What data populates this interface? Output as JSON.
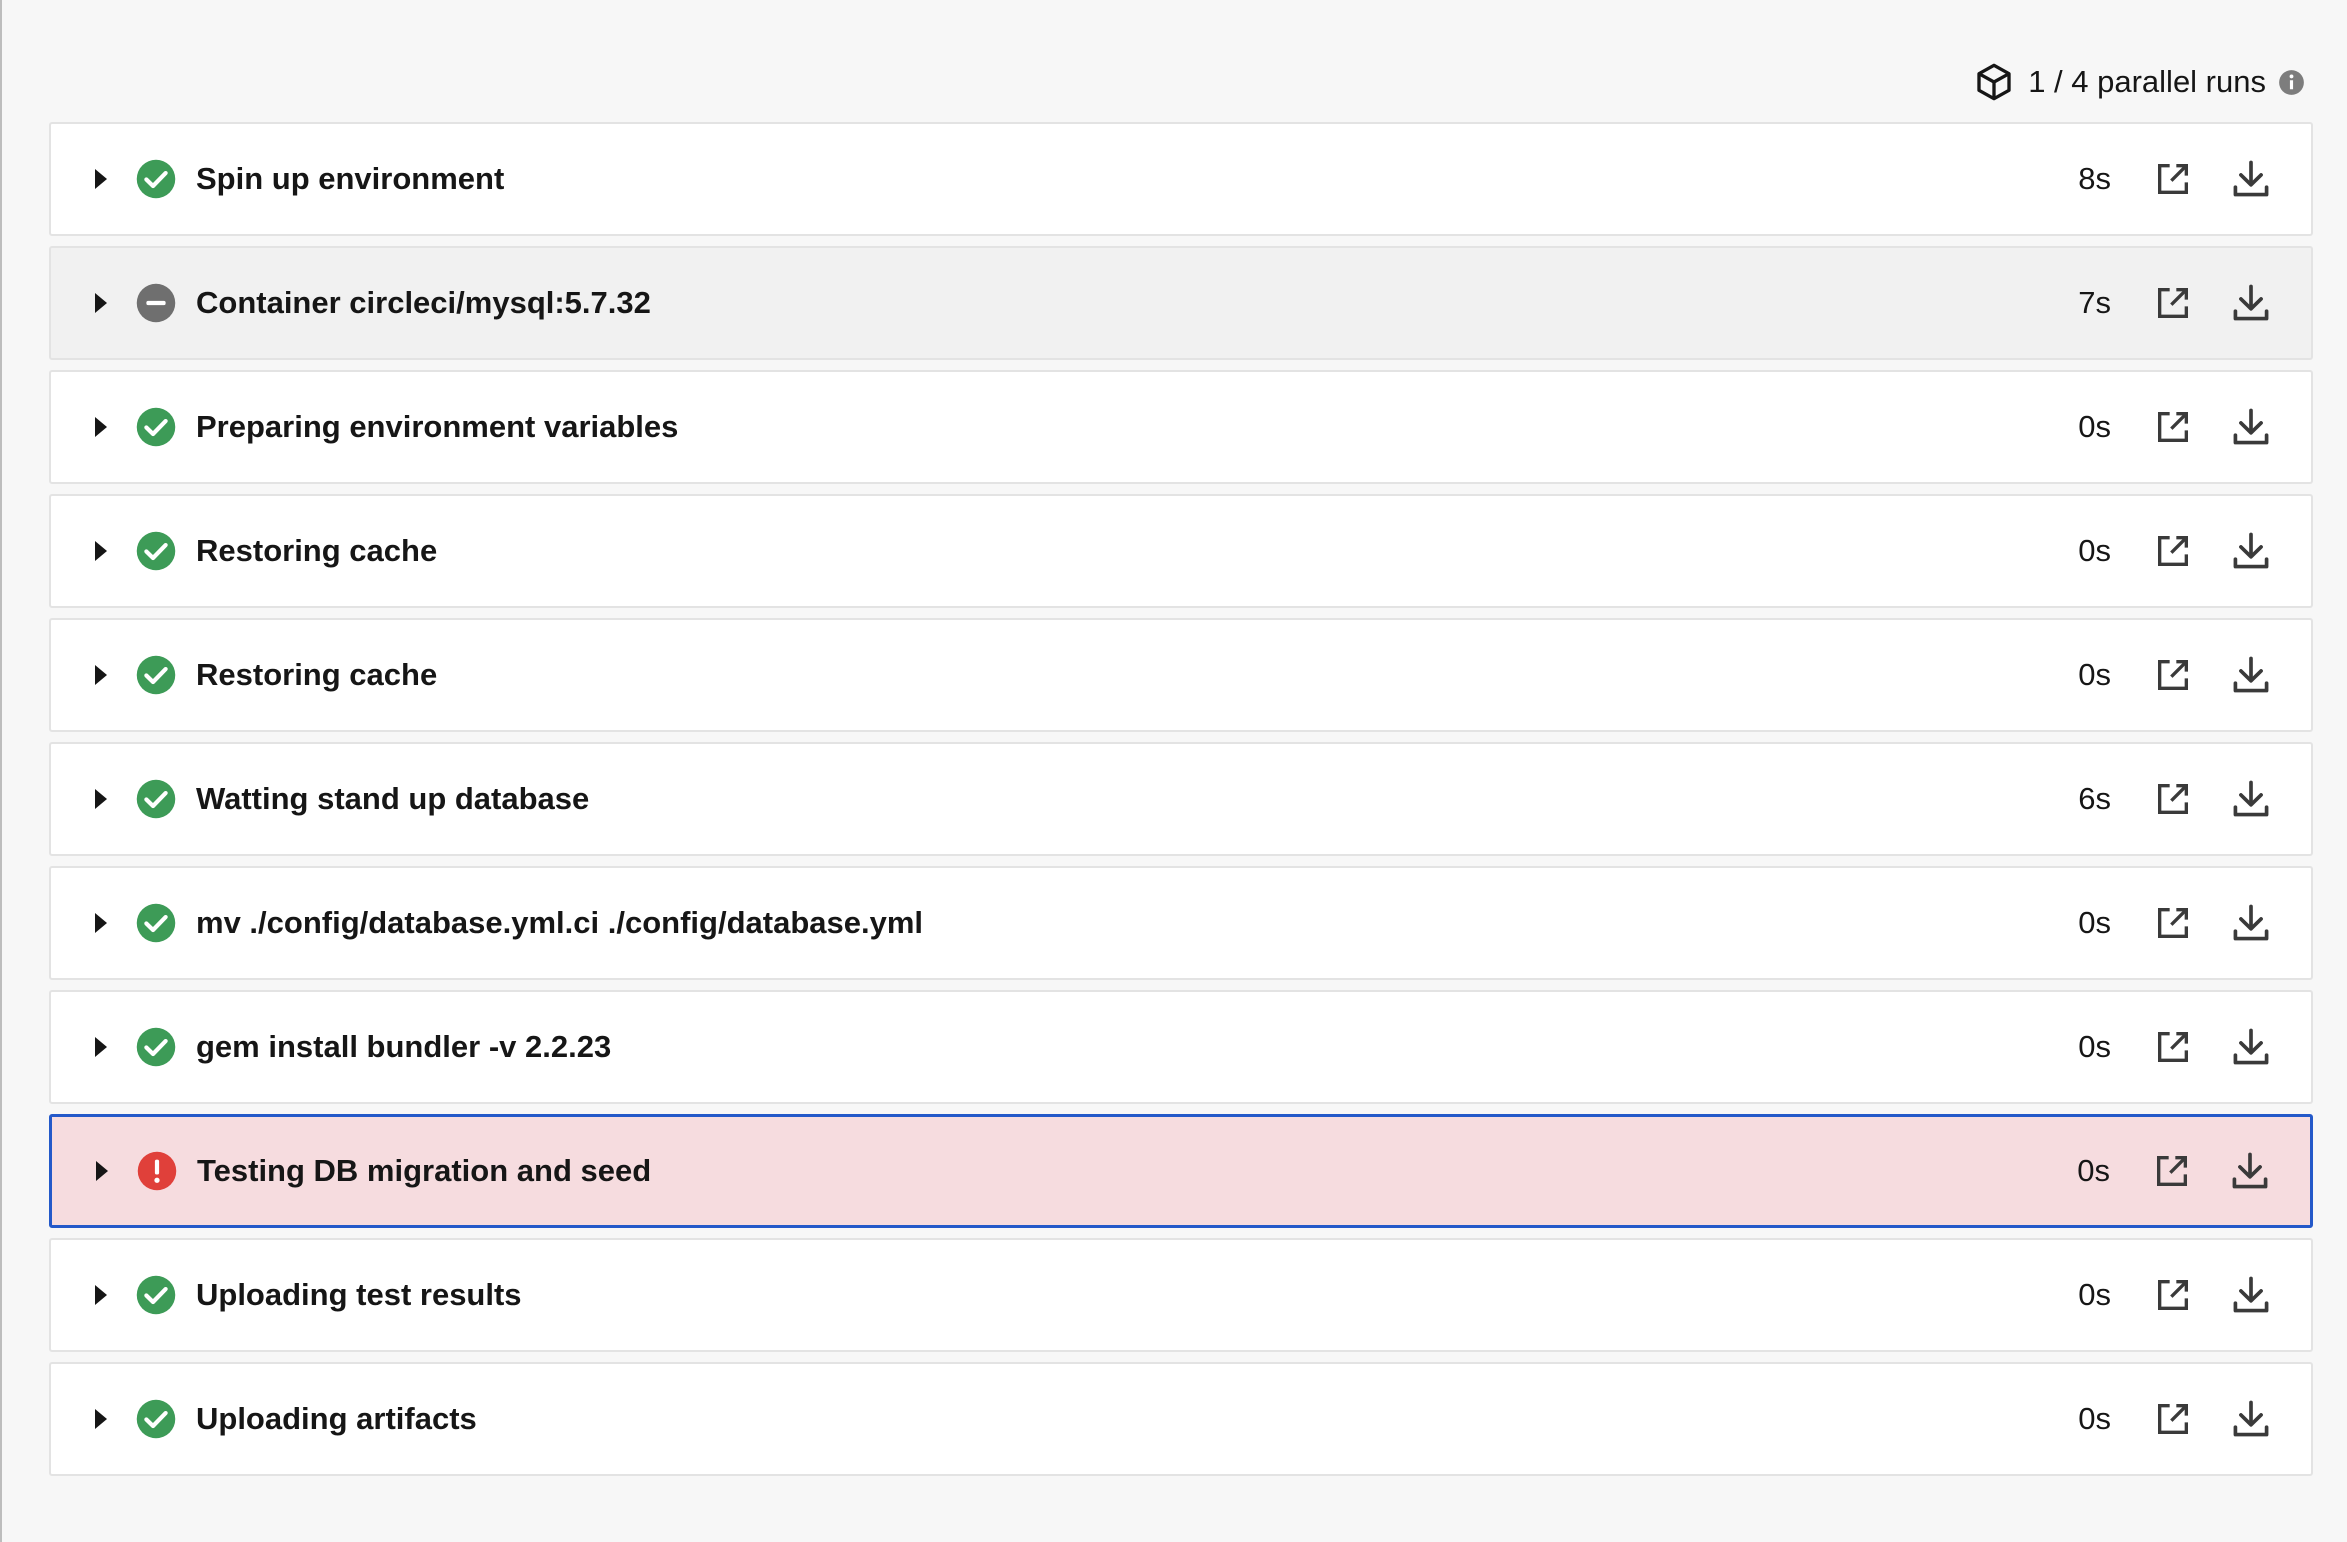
{
  "header": {
    "parallel_runs": "1 / 4 parallel runs"
  },
  "colors": {
    "success": "#3d9b57",
    "neutral": "#6f6f6f",
    "failed": "#e0403a",
    "selected_border": "#2459c9",
    "failed_background": "#f6dcdf"
  },
  "steps": [
    {
      "label": "Spin up environment",
      "duration": "8s",
      "status": "success"
    },
    {
      "label": "Container circleci/mysql:5.7.32",
      "duration": "7s",
      "status": "neutral"
    },
    {
      "label": "Preparing environment variables",
      "duration": "0s",
      "status": "success"
    },
    {
      "label": "Restoring cache",
      "duration": "0s",
      "status": "success"
    },
    {
      "label": "Restoring cache",
      "duration": "0s",
      "status": "success"
    },
    {
      "label": "Watting stand up database",
      "duration": "6s",
      "status": "success"
    },
    {
      "label": "mv ./config/database.yml.ci ./config/database.yml",
      "duration": "0s",
      "status": "success"
    },
    {
      "label": "gem install bundler -v 2.2.23",
      "duration": "0s",
      "status": "success"
    },
    {
      "label": "Testing DB migration and seed",
      "duration": "0s",
      "status": "failed"
    },
    {
      "label": "Uploading test results",
      "duration": "0s",
      "status": "success"
    },
    {
      "label": "Uploading artifacts",
      "duration": "0s",
      "status": "success"
    }
  ]
}
